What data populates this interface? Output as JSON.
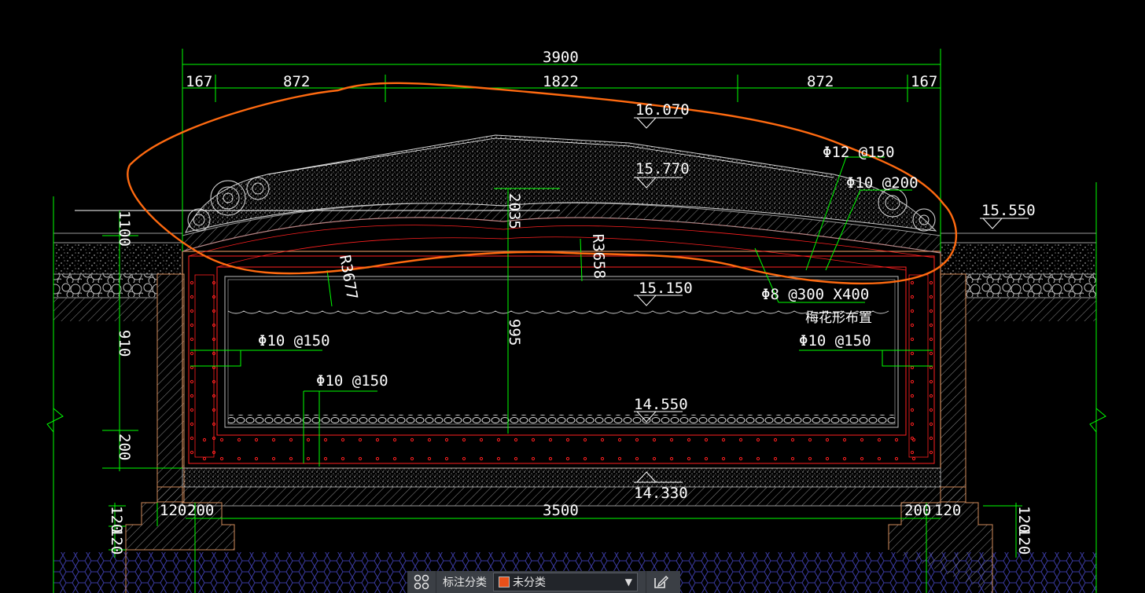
{
  "colors": {
    "background": "#000000",
    "dimension_green": "#00ff00",
    "rebar_red": "#ff2020",
    "wall_outline": "#d08a5a",
    "concrete_gray": "#9a9a9a",
    "markup_orange": "#ff6a10",
    "soil_blue": "#3a3aa0"
  },
  "drawing": {
    "top_dims": {
      "overall": "3900",
      "d1": "167",
      "d2": "872",
      "d3": "1822",
      "d4": "872",
      "d5": "167"
    },
    "bottom_dims": {
      "inner": "3500",
      "l1": "120",
      "l2": "200",
      "r1": "200",
      "r2": "120"
    },
    "vert_dims": {
      "left_top": "1100",
      "left_mid": "910",
      "left_bot": "200",
      "center": "2035",
      "center_low": "995",
      "side_left": "120",
      "side_left2": "120",
      "side_right": "120",
      "side_right2": "120"
    },
    "radius": {
      "left": "R3677",
      "right": "R3658"
    },
    "elevations": {
      "top": "16.070",
      "mound": "15.770",
      "ground": "15.550",
      "water": "15.150",
      "bottom": "14.550",
      "base": "14.330"
    },
    "rebar": {
      "top1": "Φ12 @150",
      "top2": "Φ10 @200",
      "tie": "Φ8 @300 X400",
      "tie_note": "梅花形布置",
      "wall_left": "Φ10 @150",
      "wall_right": "Φ10 @150",
      "slab": "Φ10 @150"
    }
  },
  "statusbar": {
    "label": "标注分类",
    "selected": "未分类",
    "swatch_color": "#e8501a",
    "left_icon": "grid-icon",
    "right_icon": "edit-icon"
  }
}
